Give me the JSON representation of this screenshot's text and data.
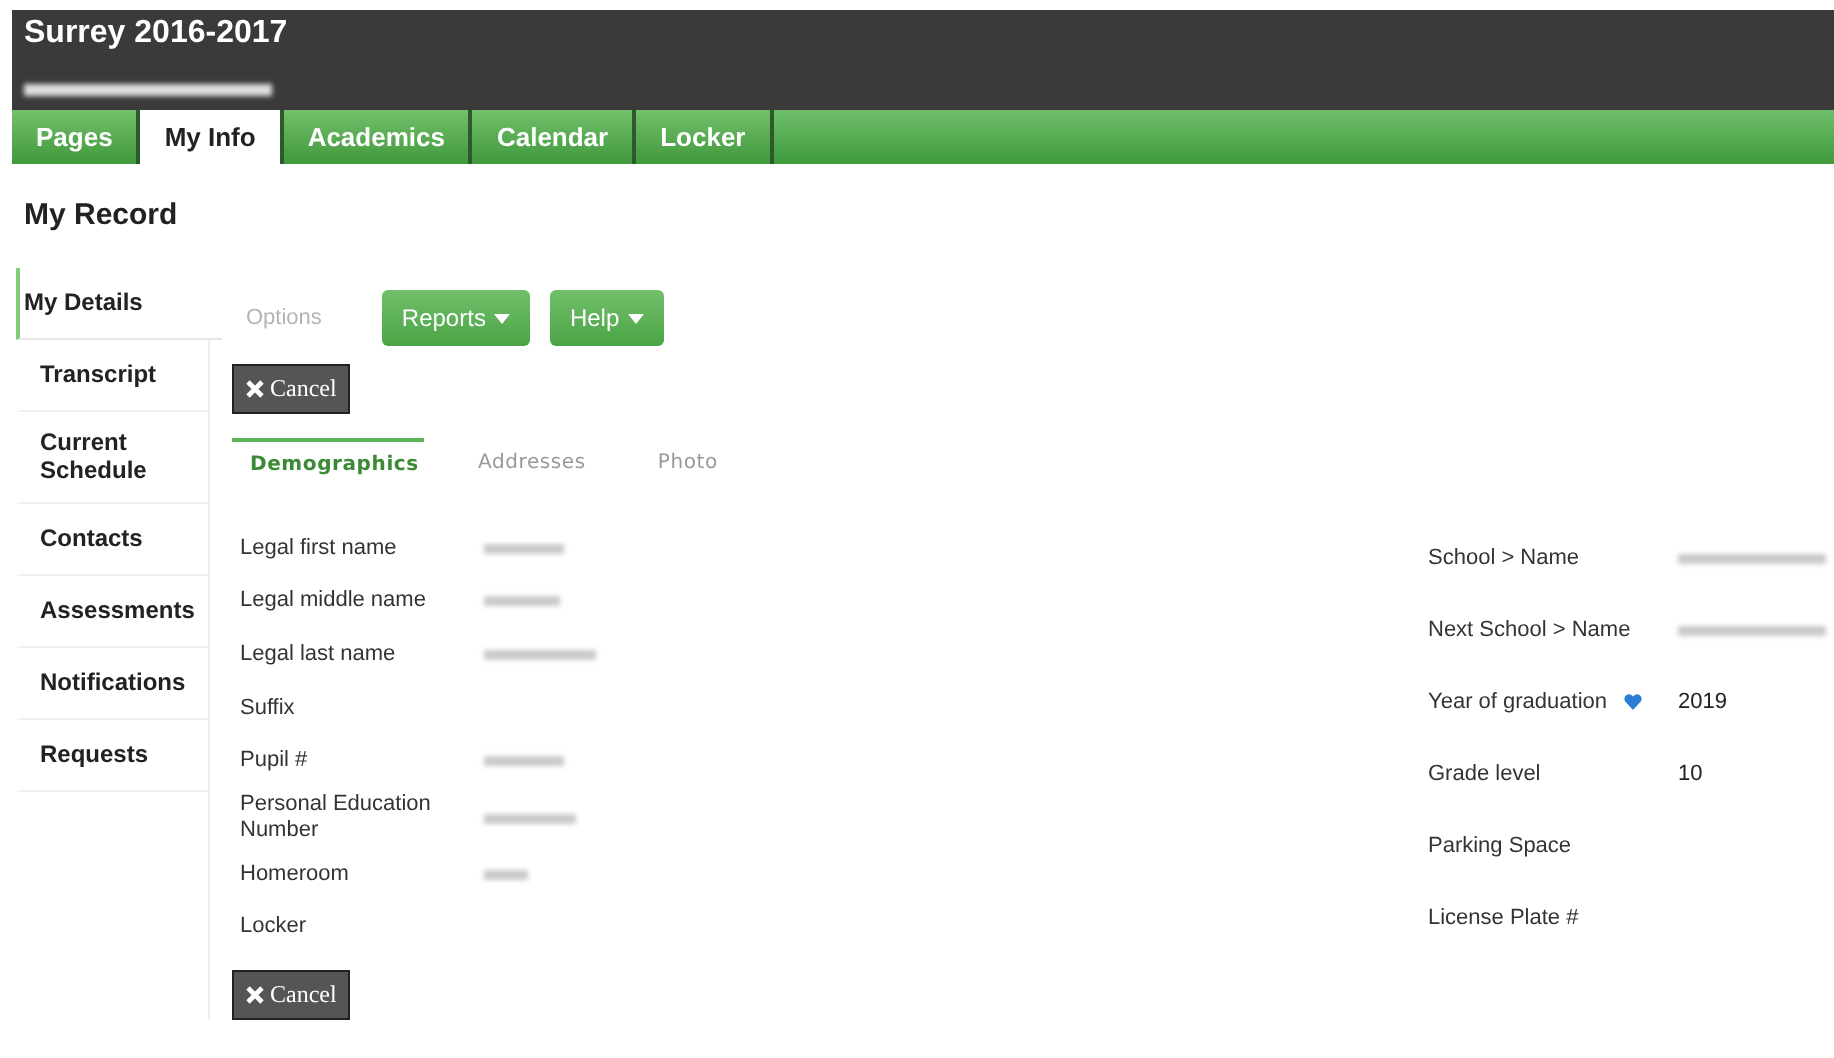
{
  "header": {
    "title": "Surrey 2016-2017",
    "subtitle_hidden": true
  },
  "tabs": [
    {
      "label": "Pages",
      "selected": false
    },
    {
      "label": "My Info",
      "selected": true
    },
    {
      "label": "Academics",
      "selected": false
    },
    {
      "label": "Calendar",
      "selected": false
    },
    {
      "label": "Locker",
      "selected": false
    }
  ],
  "page_title": "My Record",
  "sidebar": {
    "items": [
      {
        "label": "My Details",
        "selected": true
      },
      {
        "label": "Transcript",
        "selected": false
      },
      {
        "label": "Current Schedule",
        "selected": false
      },
      {
        "label": "Contacts",
        "selected": false
      },
      {
        "label": "Assessments",
        "selected": false
      },
      {
        "label": "Notifications",
        "selected": false
      },
      {
        "label": "Requests",
        "selected": false
      }
    ]
  },
  "toolbar": {
    "options": {
      "label": "Options",
      "disabled": true
    },
    "menus": [
      {
        "label": "Reports"
      },
      {
        "label": "Help"
      }
    ],
    "cancel": "Cancel"
  },
  "subtabs": [
    {
      "label": "Demographics",
      "selected": true
    },
    {
      "label": "Addresses",
      "selected": false
    },
    {
      "label": "Photo",
      "selected": false
    }
  ],
  "left_fields": [
    {
      "label": "Legal first name",
      "value_hidden": true
    },
    {
      "label": "Legal middle name",
      "value_hidden": true
    },
    {
      "label": "Legal last name",
      "value_hidden": true
    },
    {
      "label": "Suffix"
    },
    {
      "label": "Pupil #",
      "value_hidden": true
    },
    {
      "label": "Personal Education Number",
      "value_hidden": true
    },
    {
      "label": "Homeroom",
      "value_hidden": true
    },
    {
      "label": "Locker"
    }
  ],
  "right_fields": [
    {
      "label": "School > Name",
      "value_hidden": true
    },
    {
      "label": "Next School > Name",
      "value_hidden": true
    },
    {
      "label": "Year of graduation",
      "value": "2019",
      "kind": "icon"
    },
    {
      "label": "Grade level",
      "value": "10"
    },
    {
      "label": "Parking Space"
    },
    {
      "label": "License Plate #"
    }
  ],
  "bottom_cancel": "Cancel"
}
